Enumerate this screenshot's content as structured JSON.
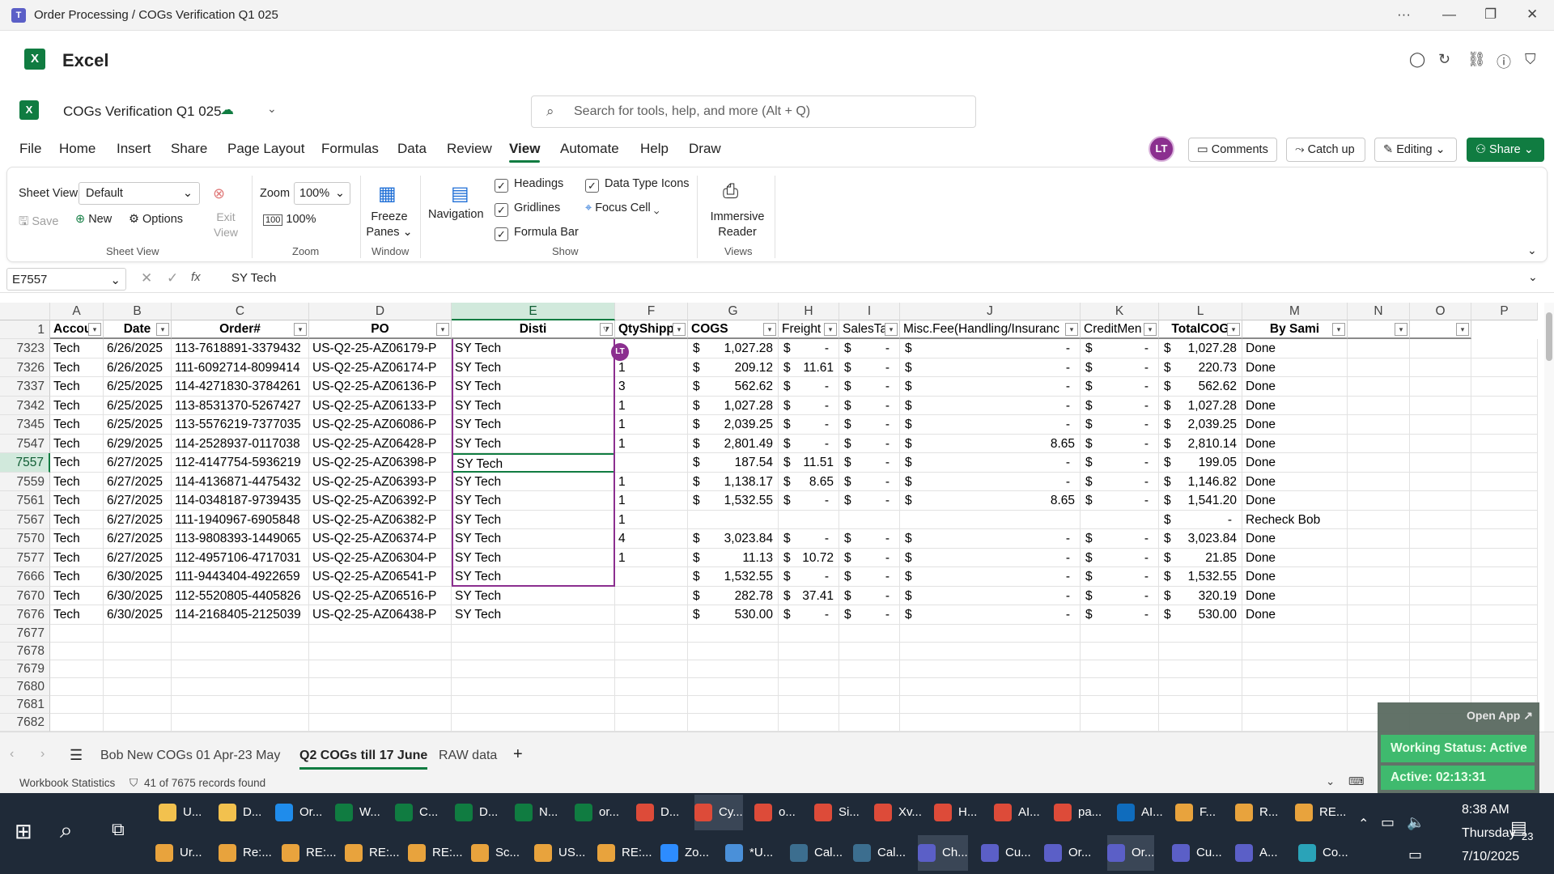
{
  "window": {
    "title": "Order Processing / COGs Verification Q1 025",
    "more": "···",
    "minimize": "—",
    "restore": "❐",
    "close": "✕"
  },
  "app": {
    "name": "Excel"
  },
  "doc": {
    "name": "COGs Verification Q1 025",
    "search_placeholder": "Search for tools, help, and more (Alt + Q)"
  },
  "menu": {
    "items": [
      "File",
      "Home",
      "Insert",
      "Share",
      "Page Layout",
      "Formulas",
      "Data",
      "Review",
      "View",
      "Automate",
      "Help",
      "Draw"
    ],
    "active": "View",
    "avatar": "LT",
    "comments": "Comments",
    "catchup": "Catch up",
    "editing": "Editing",
    "share": "Share"
  },
  "ribbon": {
    "sheet_view_label": "Sheet View",
    "sheet_view_value": "Default",
    "save": "Save",
    "new": "New",
    "options": "Options",
    "exit_view": "Exit View",
    "group_sheet_view": "Sheet View",
    "zoom_label": "Zoom",
    "zoom_value": "100%",
    "zoom_100": "100%",
    "group_zoom": "Zoom",
    "freeze": "Freeze Panes",
    "group_window": "Window",
    "navigation": "Navigation",
    "headings": "Headings",
    "gridlines": "Gridlines",
    "formula_bar": "Formula Bar",
    "data_type_icons": "Data Type Icons",
    "focus_cell": "Focus Cell",
    "group_show": "Show",
    "immersive": "Immersive Reader",
    "group_views": "Views"
  },
  "formula_bar": {
    "name_box": "E7557",
    "fx": "fx",
    "value": "SY Tech"
  },
  "columns": [
    "A",
    "B",
    "C",
    "D",
    "E",
    "F",
    "G",
    "H",
    "I",
    "J",
    "K",
    "L",
    "M",
    "N",
    "O",
    "P"
  ],
  "selected_column": "E",
  "header_row_num": "1",
  "headers": [
    "Accou",
    "Date",
    "Order#",
    "PO",
    "Disti",
    "QtyShipp",
    "COGS",
    "Freight",
    "SalesTa",
    "Misc.Fee(Handling/Insuranc",
    "CreditMen",
    "TotalCOG",
    "By Sami",
    "",
    "",
    ""
  ],
  "rows": [
    {
      "n": "7323",
      "a": "Tech",
      "b": "6/26/2025",
      "c": "113-7618891-3379432",
      "d": "US-Q2-25-AZ06179-P",
      "e": "SY Tech",
      "f": "",
      "g": "1,027.28",
      "h": "-",
      "i": "-",
      "j": "-",
      "k": "-",
      "l": "1,027.28",
      "m": "Done"
    },
    {
      "n": "7326",
      "a": "Tech",
      "b": "6/26/2025",
      "c": "111-6092714-8099414",
      "d": "US-Q2-25-AZ06174-P",
      "e": "SY Tech",
      "f": "1",
      "g": "209.12",
      "h": "11.61",
      "i": "-",
      "j": "-",
      "k": "-",
      "l": "220.73",
      "m": "Done"
    },
    {
      "n": "7337",
      "a": "Tech",
      "b": "6/25/2025",
      "c": "114-4271830-3784261",
      "d": "US-Q2-25-AZ06136-P",
      "e": "SY Tech",
      "f": "3",
      "g": "562.62",
      "h": "-",
      "i": "-",
      "j": "-",
      "k": "-",
      "l": "562.62",
      "m": "Done"
    },
    {
      "n": "7342",
      "a": "Tech",
      "b": "6/25/2025",
      "c": "113-8531370-5267427",
      "d": "US-Q2-25-AZ06133-P",
      "e": "SY Tech",
      "f": "1",
      "g": "1,027.28",
      "h": "-",
      "i": "-",
      "j": "-",
      "k": "-",
      "l": "1,027.28",
      "m": "Done"
    },
    {
      "n": "7345",
      "a": "Tech",
      "b": "6/25/2025",
      "c": "113-5576219-7377035",
      "d": "US-Q2-25-AZ06086-P",
      "e": "SY Tech",
      "f": "1",
      "g": "2,039.25",
      "h": "-",
      "i": "-",
      "j": "-",
      "k": "-",
      "l": "2,039.25",
      "m": "Done"
    },
    {
      "n": "7547",
      "a": "Tech",
      "b": "6/29/2025",
      "c": "114-2528937-0117038",
      "d": "US-Q2-25-AZ06428-P",
      "e": "SY Tech",
      "f": "1",
      "g": "2,801.49",
      "h": "-",
      "i": "-",
      "j": "8.65",
      "k": "-",
      "l": "2,810.14",
      "m": "Done"
    },
    {
      "n": "7557",
      "a": "Tech",
      "b": "6/27/2025",
      "c": "112-4147754-5936219",
      "d": "US-Q2-25-AZ06398-P",
      "e": "SY Tech",
      "f": "",
      "g": "187.54",
      "h": "11.51",
      "i": "-",
      "j": "-",
      "k": "-",
      "l": "199.05",
      "m": "Done"
    },
    {
      "n": "7559",
      "a": "Tech",
      "b": "6/27/2025",
      "c": "114-4136871-4475432",
      "d": "US-Q2-25-AZ06393-P",
      "e": "SY Tech",
      "f": "1",
      "g": "1,138.17",
      "h": "8.65",
      "i": "-",
      "j": "-",
      "k": "-",
      "l": "1,146.82",
      "m": "Done"
    },
    {
      "n": "7561",
      "a": "Tech",
      "b": "6/27/2025",
      "c": "114-0348187-9739435",
      "d": "US-Q2-25-AZ06392-P",
      "e": "SY Tech",
      "f": "1",
      "g": "1,532.55",
      "h": "-",
      "i": "-",
      "j": "8.65",
      "k": "-",
      "l": "1,541.20",
      "m": "Done"
    },
    {
      "n": "7567",
      "a": "Tech",
      "b": "6/27/2025",
      "c": "111-1940967-6905848",
      "d": "US-Q2-25-AZ06382-P",
      "e": "SY Tech",
      "f": "1",
      "g": "",
      "h": "",
      "i": "",
      "j": "",
      "k": "",
      "l": "-",
      "m": "Recheck Bob"
    },
    {
      "n": "7570",
      "a": "Tech",
      "b": "6/27/2025",
      "c": "113-9808393-1449065",
      "d": "US-Q2-25-AZ06374-P",
      "e": "SY Tech",
      "f": "4",
      "g": "3,023.84",
      "h": "-",
      "i": "-",
      "j": "-",
      "k": "-",
      "l": "3,023.84",
      "m": "Done"
    },
    {
      "n": "7577",
      "a": "Tech",
      "b": "6/27/2025",
      "c": "112-4957106-4717031",
      "d": "US-Q2-25-AZ06304-P",
      "e": "SY Tech",
      "f": "1",
      "g": "11.13",
      "h": "10.72",
      "i": "-",
      "j": "-",
      "k": "-",
      "l": "21.85",
      "m": "Done"
    },
    {
      "n": "7666",
      "a": "Tech",
      "b": "6/30/2025",
      "c": "111-9443404-4922659",
      "d": "US-Q2-25-AZ06541-P",
      "e": "SY Tech",
      "f": "",
      "g": "1,532.55",
      "h": "-",
      "i": "-",
      "j": "-",
      "k": "-",
      "l": "1,532.55",
      "m": "Done"
    },
    {
      "n": "7670",
      "a": "Tech",
      "b": "6/30/2025",
      "c": "112-5520805-4405826",
      "d": "US-Q2-25-AZ06516-P",
      "e": "SY Tech",
      "f": "",
      "g": "282.78",
      "h": "37.41",
      "i": "-",
      "j": "-",
      "k": "-",
      "l": "320.19",
      "m": "Done"
    },
    {
      "n": "7676",
      "a": "Tech",
      "b": "6/30/2025",
      "c": "114-2168405-2125039",
      "d": "US-Q2-25-AZ06438-P",
      "e": "SY Tech",
      "f": "",
      "g": "530.00",
      "h": "-",
      "i": "-",
      "j": "-",
      "k": "-",
      "l": "530.00",
      "m": "Done"
    }
  ],
  "empty_rows": [
    "7677",
    "7678",
    "7679",
    "7680",
    "7681",
    "7682"
  ],
  "currency": "$",
  "collab_avatar": "LT",
  "sheet_tabs": [
    "Bob New COGs 01 Apr-23 May",
    "Q2 COGs till 17 June",
    "RAW data"
  ],
  "active_tab": "Q2 COGs till 17 June",
  "add_sheet": "+",
  "status": {
    "workbook_stats": "Workbook Statistics",
    "filter_info": "41 of 7675 records found",
    "zoom": "100%"
  },
  "widget": {
    "open_app": "Open App ↗",
    "working_status": "Working Status: Active",
    "active_time": "Active: 02:13:31"
  },
  "taskbar": {
    "row1": [
      "U...",
      "D...",
      "Or...",
      "W...",
      "C...",
      "D...",
      "N...",
      "or...",
      "D...",
      "Cy...",
      "o...",
      "Si...",
      "Xv...",
      "H...",
      "AI...",
      "pa...",
      "AI...",
      "F...",
      "R...",
      "RE..."
    ],
    "row2": [
      "Ur...",
      "Re:...",
      "RE:...",
      "RE:...",
      "RE:...",
      "Sc...",
      "US...",
      "RE:...",
      "Zo...",
      "*U...",
      "Cal...",
      "Cal...",
      "Ch...",
      "Cu...",
      "Or...",
      "Or...",
      "Cu...",
      "A...",
      "Co..."
    ],
    "time": "8:38 AM",
    "day": "Thursday",
    "date": "7/10/2025",
    "notif": "23"
  },
  "colors": {
    "excel_green": "#107c41",
    "selection_purple": "#8b2f8f",
    "taskbar": "#1f2a38"
  }
}
